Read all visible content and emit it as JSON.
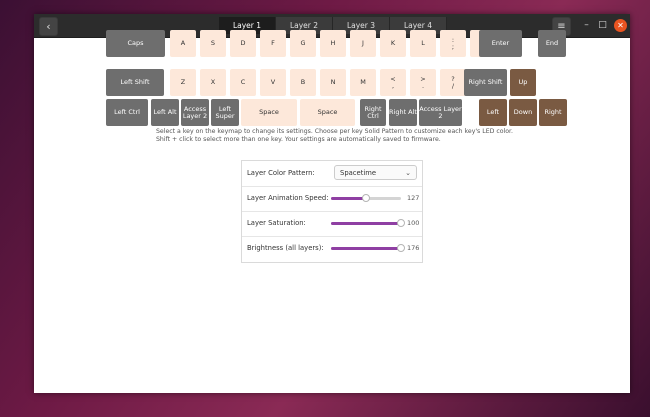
{
  "tabs": [
    {
      "label": "Layer 1",
      "active": true
    },
    {
      "label": "Layer 2",
      "active": false
    },
    {
      "label": "Layer 3",
      "active": false
    },
    {
      "label": "Layer 4",
      "active": false
    }
  ],
  "icons": {
    "back": "chevron-left-icon",
    "menu": "hamburger-menu-icon",
    "minimize": "minimize-icon",
    "maximize": "maximize-icon",
    "close": "close-icon"
  },
  "keyboard": {
    "row1": [
      "Caps",
      "A",
      "S",
      "D",
      "F",
      "G",
      "H",
      "J",
      "K",
      "L",
      ";",
      "'",
      "Enter",
      "End"
    ],
    "row1_alt": {
      ";": ":",
      "'": "\""
    },
    "row2": [
      "Left Shift",
      "Z",
      "X",
      "C",
      "V",
      "B",
      "N",
      "M",
      ",",
      ".",
      "/",
      "Right Shift",
      "Up"
    ],
    "row2_alt": {
      ",": "<",
      ".": ">",
      "/": "?"
    },
    "row3": [
      "Left Ctrl",
      "Left Alt",
      "Access Layer 2",
      "Left Super",
      "Space",
      "Space",
      "Right Ctrl",
      "Right Alt",
      "Access Layer 2",
      "Left",
      "Down",
      "Right"
    ]
  },
  "info": {
    "line1": "Select a key on the keymap to change its settings. Choose per key Solid Pattern to customize each key's LED color.",
    "line2": "Shift + click to select more than one key. Your settings are automatically saved to firmware."
  },
  "settings": {
    "color_pattern_label": "Layer Color Pattern:",
    "color_pattern_value": "Spacetime",
    "animation_speed_label": "Layer Animation Speed:",
    "animation_speed_value": "127",
    "animation_speed_level": 127,
    "saturation_label": "Layer Saturation:",
    "saturation_value": "100",
    "saturation_level": 100,
    "brightness_label": "Brightness (all layers):",
    "brightness_value": "176",
    "brightness_level": 176,
    "slider_max": 255
  },
  "colors": {
    "accent": "#8f3fa3",
    "key_light": "#fde8da",
    "key_dark": "#6e6e6e",
    "key_brown": "#7a5a42",
    "close": "#e95420"
  }
}
